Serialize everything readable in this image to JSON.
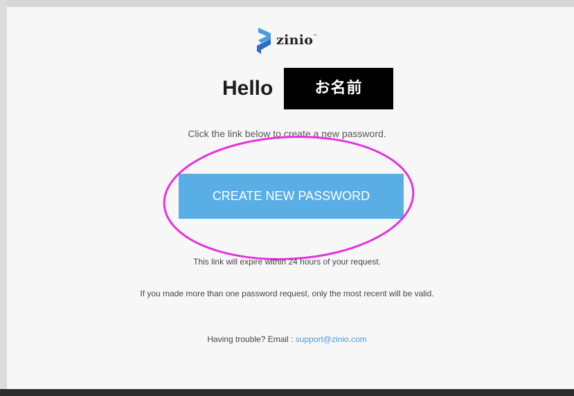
{
  "brand": {
    "logo_text": "zinio",
    "logo_mark_color": "#2a6fc4",
    "logo_mark_color_light": "#4a9be0"
  },
  "greeting": {
    "hello": "Hello",
    "redacted_name": "お名前"
  },
  "body": {
    "intro": "Click the link below to create a new password.",
    "button_label": "CREATE NEW PASSWORD",
    "expire_notice": "This link will expire within 24 hours of your request.",
    "multiple_requests_notice": "If you made more than one password request, only the most recent will be valid.",
    "help_prefix": "Having trouble? Email : ",
    "support_email": "support@zinio.com"
  },
  "colors": {
    "button": "#5aaee6",
    "highlight_annotation": "#e830e0",
    "link": "#4d9ad6",
    "card_background": "#f7f7f7"
  }
}
